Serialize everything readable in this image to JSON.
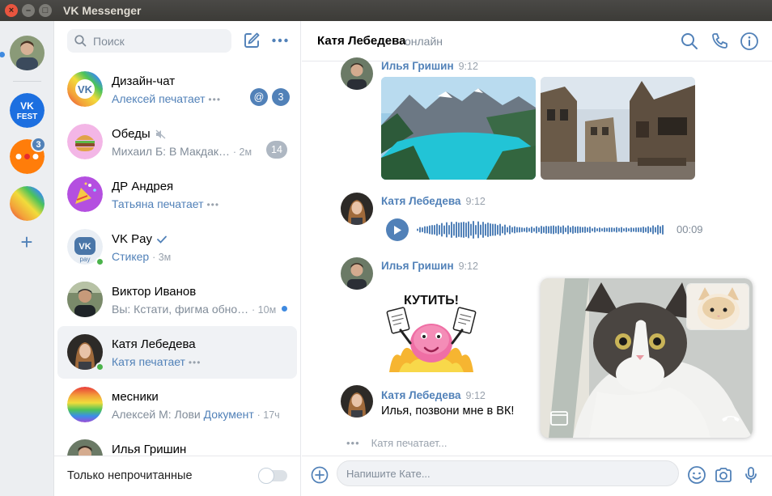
{
  "window": {
    "title": "VK Messenger"
  },
  "rail": {
    "folders": [
      {
        "name": "profile",
        "unread_marker": true
      },
      {
        "name": "vk-fest"
      },
      {
        "name": "chats-folder",
        "badge": "3"
      },
      {
        "name": "rainbow-folder"
      }
    ]
  },
  "search": {
    "placeholder": "Поиск"
  },
  "chats": [
    {
      "name": "Дизайн-чат",
      "preview_blue": "Алексей печатает",
      "typing": true,
      "mention": "@",
      "badge": "3"
    },
    {
      "name": "Обеды",
      "muted": true,
      "preview": "Михаил Б: В Макдак…",
      "time": "· 2м",
      "badge": "14"
    },
    {
      "name": "ДР Андрея",
      "preview_blue": "Татьяна печатает",
      "typing": true
    },
    {
      "name": "VK Pay",
      "verified": true,
      "preview_blue": "Стикер",
      "time": "· 3м",
      "online": true
    },
    {
      "name": "Виктор Иванов",
      "preview": "Вы: Кстати, фигма обно…",
      "time": "· 10м",
      "unread": true
    },
    {
      "name": "Катя Лебедева",
      "preview_blue": "Катя печатает",
      "typing": true,
      "online": true,
      "active": true
    },
    {
      "name": "месники",
      "preview": "Алексей М: Лови ",
      "preview_link": "Документ",
      "time": "· 17ч"
    },
    {
      "name": "Илья Гришин"
    }
  ],
  "footer": {
    "unread_only_label": "Только непрочитанные"
  },
  "conversation": {
    "title": "Катя Лебедева",
    "status": "онлайн",
    "messages": [
      {
        "author": "Илья Гришин",
        "time": "9:12",
        "kind": "photos"
      },
      {
        "author": "Катя Лебедева",
        "time": "9:12",
        "kind": "voice",
        "duration": "00:09"
      },
      {
        "author": "Илья Гришин",
        "time": "9:12",
        "kind": "sticker",
        "sticker_text": "КУТИТЬ!"
      },
      {
        "author": "Катя Лебедева",
        "time": "9:12",
        "kind": "text",
        "text": "Илья, позвони мне в ВК!"
      }
    ],
    "typing_text": "Катя печатает...",
    "composer_placeholder": "Напишите Кате..."
  },
  "colors": {
    "accent": "#5181b8",
    "online": "#4bb34b",
    "titlebar": "#3c3b37",
    "close_button": "#e9553f"
  },
  "icons": [
    "search-icon",
    "compose-icon",
    "more-icon",
    "phone-icon",
    "info-icon",
    "plus-icon",
    "emoji-icon",
    "camera-icon",
    "mic-icon",
    "play-icon",
    "mute-icon",
    "verified-icon"
  ]
}
